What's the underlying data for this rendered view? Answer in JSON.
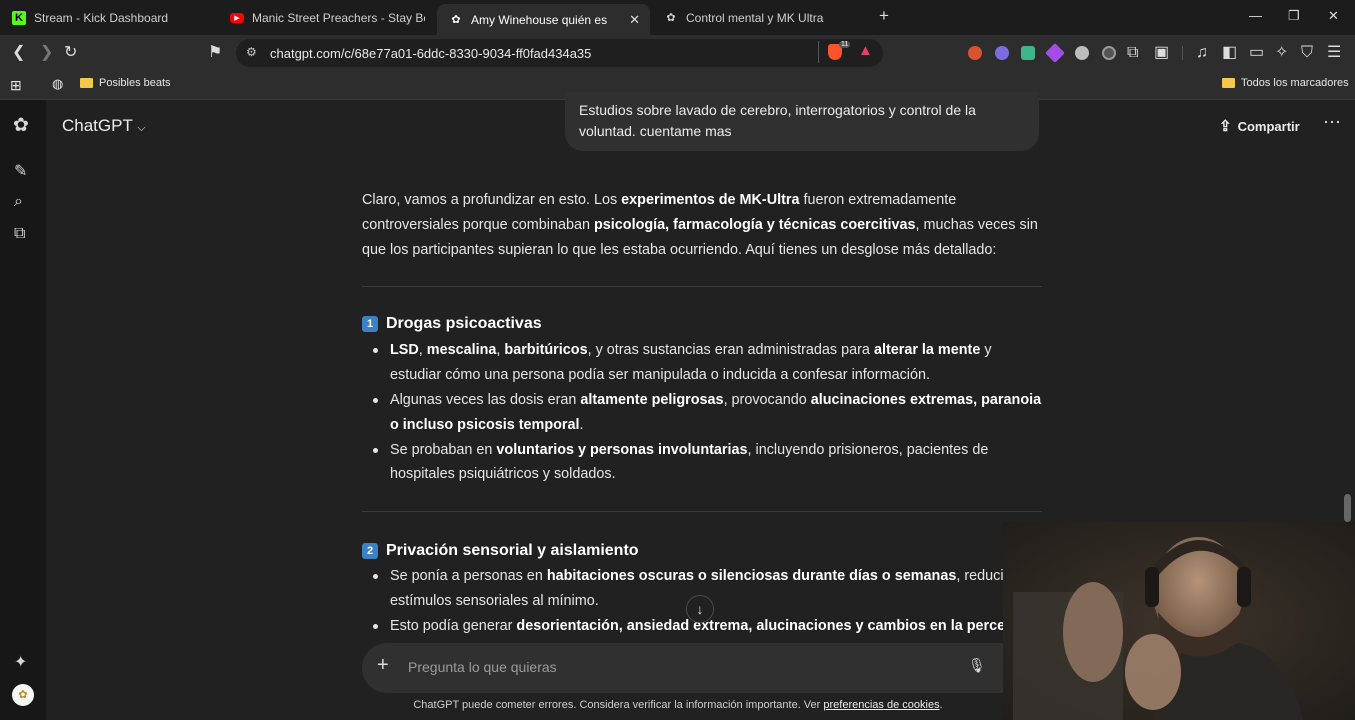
{
  "browser": {
    "tabs": [
      {
        "title": "Stream - Kick Dashboard",
        "favicon": "kick-icon",
        "active": false
      },
      {
        "title": "Manic Street Preachers - Stay Beautifu",
        "favicon": "youtube-icon",
        "active": false
      },
      {
        "title": "Amy Winehouse quién es",
        "favicon": "chatgpt-icon",
        "active": true
      },
      {
        "title": "Control mental y MK Ultra",
        "favicon": "chatgpt-icon",
        "active": false
      }
    ],
    "url": "chatgpt.com/c/68e77a01-6ddc-8330-9034-ff0fad434a35",
    "brave_badge": "11",
    "bookmarks": {
      "left_folder": "Posibles beats",
      "right_folder": "Todos los marcadores"
    }
  },
  "app": {
    "title": "ChatGPT",
    "share_label": "Compartir"
  },
  "chat": {
    "user_message": "Estudios sobre lavado de cerebro, interrogatorios y control de la voluntad. cuentame mas",
    "intro": {
      "t1": "Claro, vamos a profundizar en esto. Los ",
      "b1": "experimentos de MK-Ultra",
      "t2": " fueron extremadamente controversiales porque combinaban ",
      "b2": "psicología, farmacología y técnicas coercitivas",
      "t3": ", muchas veces sin que los participantes supieran lo que les estaba ocurriendo. Aquí tienes un desglose más detallado:"
    },
    "section1": {
      "number": "1",
      "heading": "Drogas psicoactivas",
      "b1": {
        "b1": "LSD",
        "t1": ", ",
        "b2": "mescalina",
        "t2": ", ",
        "b3": "barbitúricos",
        "t3": ", y otras sustancias eran administradas para ",
        "b4": "alterar la mente",
        "t4": " y estudiar cómo una persona podía ser manipulada o inducida a confesar información."
      },
      "b2": {
        "t1": "Algunas veces las dosis eran ",
        "b1": "altamente peligrosas",
        "t2": ", provocando ",
        "b2": "alucinaciones extremas, paranoia o incluso psicosis temporal",
        "t3": "."
      },
      "b3": {
        "t1": "Se probaban en ",
        "b1": "voluntarios y personas involuntarias",
        "t2": ", incluyendo prisioneros, pacientes de hospitales psiquiátricos y soldados."
      }
    },
    "section2": {
      "number": "2",
      "heading": "Privación sensorial y aislamiento",
      "b1": {
        "t1": "Se ponía a personas en ",
        "b1": "habitaciones oscuras o silenciosas durante días o semanas",
        "t2": ", reduciendo estímulos sensoriales al mínimo."
      },
      "b2": {
        "t1": "Esto podía generar ",
        "b1": "desorientación, ansiedad extrema, alucinaciones y cambios en la percepción d"
      }
    }
  },
  "composer": {
    "placeholder": "Pregunta lo que quieras"
  },
  "footer": {
    "text": "ChatGPT puede cometer errores. Considera verificar la información importante. Ver ",
    "link": "preferencias de cookies",
    "end": "."
  },
  "colors": {
    "background": "#212121",
    "sidebar": "#171717",
    "bubble": "#303030",
    "accent": "#3b82c4"
  }
}
